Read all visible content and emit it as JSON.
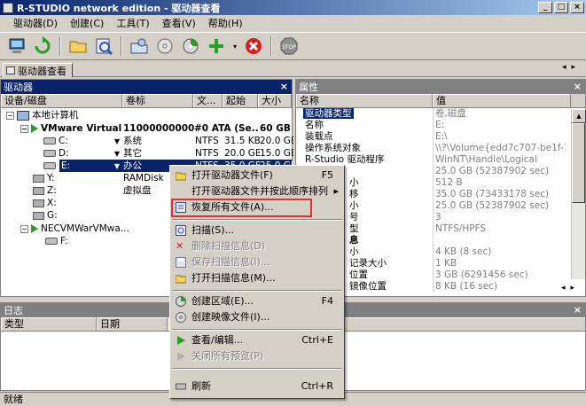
{
  "window": {
    "title": "R-STUDIO network edition - 驱动器查看",
    "buttons": [
      "_",
      "□",
      "×"
    ]
  },
  "menubar": [
    {
      "label": "驱动器(D)"
    },
    {
      "label": "创建(C)"
    },
    {
      "label": "工具(T)"
    },
    {
      "label": "查看(V)"
    },
    {
      "label": "帮助(H)"
    }
  ],
  "tab": {
    "label": "驱动器查看"
  },
  "drives_panel": {
    "title": "驱动器",
    "columns": [
      "设备/磁盘",
      "卷标",
      "文...",
      "起始",
      "大小"
    ],
    "rows": [
      {
        "name": "本地计算机",
        "label": "",
        "fs": "",
        "start": "",
        "size": ""
      },
      {
        "name": "VMware Virtual...",
        "label": "11000000000...",
        "fs": "#0  ATA (Se...",
        "start": "",
        "size": "60 GB"
      },
      {
        "name": "C:",
        "label": "系统",
        "fs": "NTFS",
        "start": "31.5 KB",
        "size": "20.0 GB"
      },
      {
        "name": "D:",
        "label": "其它",
        "fs": "NTFS",
        "start": "20.0 GB",
        "size": "15.0 GB"
      },
      {
        "name": "E:",
        "label": "办公",
        "fs": "NTFS",
        "start": "35.0 GB",
        "size": "25.0 GB"
      },
      {
        "name": "Y:",
        "label": "RAMDisk",
        "fs": "",
        "start": "",
        "size": ""
      },
      {
        "name": "Z:",
        "label": "虚拟盘",
        "fs": "",
        "start": "",
        "size": ""
      },
      {
        "name": "X:",
        "label": "",
        "fs": "",
        "start": "",
        "size": ""
      },
      {
        "name": "G:",
        "label": "",
        "fs": "",
        "start": "",
        "size": ""
      },
      {
        "name": "NECVMWarVMwa...",
        "label": "",
        "fs": "",
        "start": "",
        "size": ""
      },
      {
        "name": "F:",
        "label": "",
        "fs": "",
        "start": "",
        "size": ""
      }
    ]
  },
  "properties_panel": {
    "title": "属性",
    "columns": [
      "名称",
      "值"
    ],
    "rows": [
      {
        "name": "驱动器类型",
        "value": "卷,磁盘"
      },
      {
        "name": "名称",
        "value": "E:"
      },
      {
        "name": "装载点",
        "value": "E:\\"
      },
      {
        "name": "操作系统对象",
        "value": "\\\\?\\Volume{edd7c707-be1f-11..."
      },
      {
        "name": "R-Studio 驱动程序",
        "value": "WinNT\\Handle\\Logical"
      },
      {
        "name": "",
        "value": "25.0 GB (52387902 sec)"
      },
      {
        "name": "小",
        "value": "512 B"
      },
      {
        "name": "移",
        "value": "35.0 GB (73433178 sec)"
      },
      {
        "name": "小",
        "value": "25.0 GB (52387902 sec)"
      },
      {
        "name": "号",
        "value": "3"
      },
      {
        "name": "型",
        "value": "NTFS/HPFS"
      },
      {
        "name": "息",
        "value": ""
      },
      {
        "name": "小",
        "value": "4 KB (8 sec)"
      },
      {
        "name": "记录大小",
        "value": "1 KB"
      },
      {
        "name": "位置",
        "value": "3 GB (6291456 sec)"
      },
      {
        "name": "镜像位置",
        "value": "8 KB (16 sec)"
      }
    ]
  },
  "log_panel": {
    "title": "日志",
    "columns": [
      "类型",
      "日期"
    ]
  },
  "context_menu": {
    "items": [
      {
        "label": "打开驱动器文件(F)",
        "shortcut": "F5",
        "disabled": false
      },
      {
        "label": "打开驱动器文件并按此顺序排列",
        "shortcut": "",
        "disabled": false,
        "submenu": "▸"
      },
      {
        "label": "恢复所有文件(A)...",
        "shortcut": "",
        "disabled": false
      },
      {
        "label": "扫描(S)...",
        "shortcut": "",
        "disabled": false
      },
      {
        "label": "删除扫描信息(D)",
        "shortcut": "",
        "disabled": true
      },
      {
        "label": "保存扫描信息(I)...",
        "shortcut": "",
        "disabled": true
      },
      {
        "label": "打开扫描信息(M)...",
        "shortcut": "",
        "disabled": false
      },
      {
        "label": "创建区域(E)...",
        "shortcut": "F4",
        "disabled": false
      },
      {
        "label": "创建映像文件(I)...",
        "shortcut": "",
        "disabled": false
      },
      {
        "label": "查看/编辑...",
        "shortcut": "Ctrl+E",
        "disabled": false
      },
      {
        "label": "关闭所有预览(P)",
        "shortcut": "",
        "disabled": true
      },
      {
        "label": "刷新",
        "shortcut": "Ctrl+R",
        "disabled": false
      }
    ]
  },
  "statusbar": {
    "text": "就绪"
  },
  "colors": {
    "selection": "#0a246a",
    "panel_title": "#0a246a",
    "highlight_box": "#e23030"
  }
}
